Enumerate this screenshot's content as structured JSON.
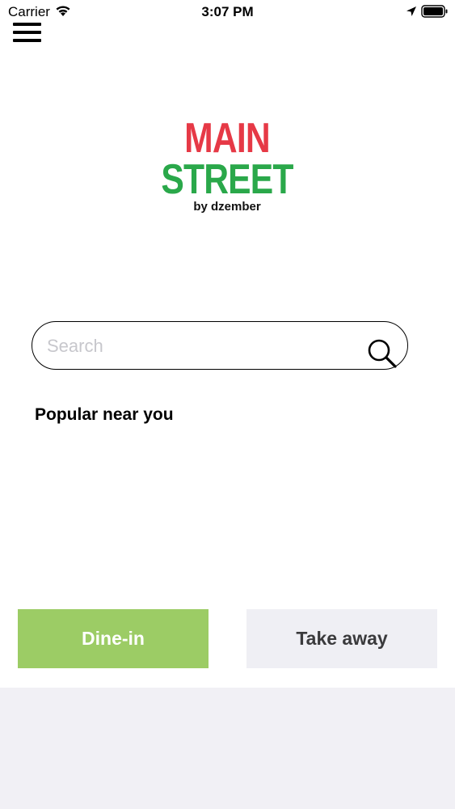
{
  "status_bar": {
    "carrier": "Carrier",
    "time": "3:07 PM"
  },
  "logo": {
    "line1": "MAIN",
    "line2": "STREET",
    "line3": "by dzember",
    "colors": {
      "main": "#e63946",
      "street": "#2aa84a"
    }
  },
  "search": {
    "placeholder": "Search",
    "value": ""
  },
  "section": {
    "title": "Popular near you"
  },
  "actions": {
    "dine_in": "Dine-in",
    "take_away": "Take away",
    "dine_in_color": "#9ccc65",
    "take_away_color": "#efeff4"
  },
  "icons": {
    "menu": "hamburger-menu-icon",
    "search": "search-icon",
    "wifi": "wifi-icon",
    "location": "location-arrow-icon",
    "battery": "battery-icon"
  }
}
